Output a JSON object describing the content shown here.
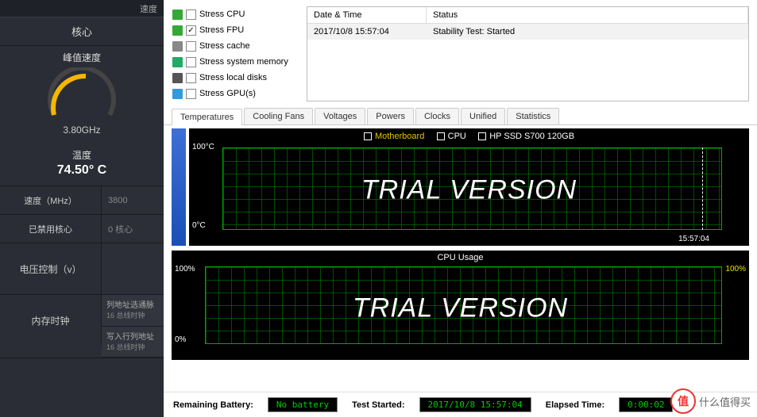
{
  "sidebar": {
    "top_item": "速度",
    "core_label": "核心",
    "gauge_title": "峰值速度",
    "gauge_value": "3.80GHz",
    "temp_label": "温度",
    "temp_value": "74.50° C",
    "rows": [
      {
        "label": "速度（MHz）",
        "value": "3800"
      },
      {
        "label": "已禁用核心",
        "value": "0 核心"
      }
    ],
    "voltage_label": "电压控制（v）",
    "mem_label": "内存时钟",
    "mem_items": [
      {
        "line1": "列地址选通脉",
        "line2": "16 总线时钟"
      },
      {
        "line1": "写入行列地址",
        "line2": "16 总线时钟"
      }
    ]
  },
  "stress": [
    {
      "icon": "cpu",
      "name": "cpu",
      "checked": false,
      "label": "Stress CPU"
    },
    {
      "icon": "fpu",
      "name": "fpu",
      "checked": true,
      "label": "Stress FPU"
    },
    {
      "icon": "cache",
      "name": "cache",
      "checked": false,
      "label": "Stress cache"
    },
    {
      "icon": "mem",
      "name": "mem",
      "checked": false,
      "label": "Stress system memory"
    },
    {
      "icon": "disk",
      "name": "disk",
      "checked": false,
      "label": "Stress local disks"
    },
    {
      "icon": "gpu",
      "name": "gpu",
      "checked": false,
      "label": "Stress GPU(s)"
    }
  ],
  "log": {
    "head_dt": "Date & Time",
    "head_status": "Status",
    "rows": [
      {
        "dt": "2017/10/8 15:57:04",
        "status": "Stability Test: Started"
      }
    ]
  },
  "tabs": [
    "Temperatures",
    "Cooling Fans",
    "Voltages",
    "Powers",
    "Clocks",
    "Unified",
    "Statistics"
  ],
  "active_tab": 0,
  "temp_chart": {
    "legend": [
      {
        "label": "Motherboard",
        "color": "#e6c200"
      },
      {
        "label": "CPU",
        "color": "#ffffff"
      },
      {
        "label": "HP SSD S700 120GB",
        "color": "#ffffff"
      }
    ],
    "ymax": "100°C",
    "ymin": "0°C",
    "xmark": "15:57:04",
    "overlay": "TRIAL VERSION"
  },
  "usage_chart": {
    "title": "CPU Usage",
    "ymax": "100%",
    "ymin": "0%",
    "ymax_r": "100%",
    "overlay": "TRIAL VERSION"
  },
  "status": {
    "battery_label": "Remaining Battery:",
    "battery_value": "No battery",
    "started_label": "Test Started:",
    "started_value": "2017/10/8 15:57:04",
    "elapsed_label": "Elapsed Time:",
    "elapsed_value": "0:00:02"
  },
  "watermark": {
    "badge": "值",
    "text": "什么值得买"
  },
  "chart_data": [
    {
      "type": "line",
      "title": "Temperatures",
      "ylabel": "°C",
      "ylim": [
        0,
        100
      ],
      "x": [
        "15:57:04"
      ],
      "series": [
        {
          "name": "Motherboard",
          "values": []
        },
        {
          "name": "CPU",
          "values": []
        },
        {
          "name": "HP SSD S700 120GB",
          "values": []
        }
      ]
    },
    {
      "type": "line",
      "title": "CPU Usage",
      "ylabel": "%",
      "ylim": [
        0,
        100
      ],
      "x": [],
      "series": [
        {
          "name": "CPU Usage",
          "values": []
        }
      ]
    }
  ]
}
